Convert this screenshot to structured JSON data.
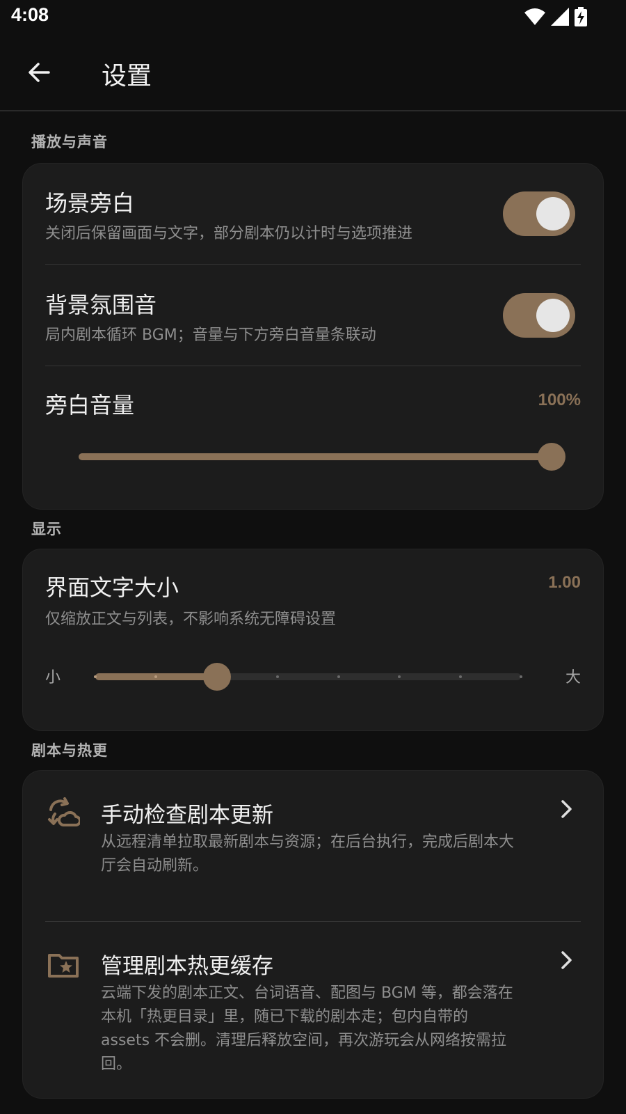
{
  "status_bar": {
    "time": "4:08",
    "icons": [
      "wifi-icon",
      "cell-signal-icon",
      "battery-charging-icon"
    ]
  },
  "app_bar": {
    "back_icon": "arrow-left-icon",
    "title": "设置"
  },
  "sections": {
    "playback": {
      "title": "播放与声音",
      "narration": {
        "title": "场景旁白",
        "subtitle": "关闭后保留画面与文字，部分剧本仍以计时与选项推进",
        "enabled": true
      },
      "ambient": {
        "title": "背景氛围音",
        "subtitle": "局内剧本循环 BGM；音量与下方旁白音量条联动",
        "enabled": true
      },
      "volume": {
        "title": "旁白音量",
        "value_text": "100%",
        "value": 1.0
      }
    },
    "display": {
      "title": "显示",
      "text_size": {
        "title": "界面文字大小",
        "value_text": "1.00",
        "subtitle": "仅缩放正文与列表，不影响系统无障碍设置",
        "min_label": "小",
        "max_label": "大",
        "fraction": 0.286,
        "steps": 7
      }
    },
    "scripts": {
      "title": "剧本与热更",
      "check_update": {
        "icon": "cloud-sync-icon",
        "title": "手动检查剧本更新",
        "subtitle": "从远程清单拉取最新剧本与资源；在后台执行，完成后剧本大厅会自动刷新。",
        "chevron": "chevron-right-icon"
      },
      "manage_cache": {
        "icon": "folder-star-icon",
        "title": "管理剧本热更缓存",
        "subtitle": "云端下发的剧本正文、台词语音、配图与 BGM 等，都会落在本机「热更目录」里，随已下载的剧本走；包内自带的 assets 不会删。清理后释放空间，再次游玩会从网络按需拉回。",
        "chevron": "chevron-right-icon"
      }
    }
  },
  "colors": {
    "accent": "#8a7157",
    "background": "#0f0f0f",
    "card": "#1c1c1c"
  }
}
